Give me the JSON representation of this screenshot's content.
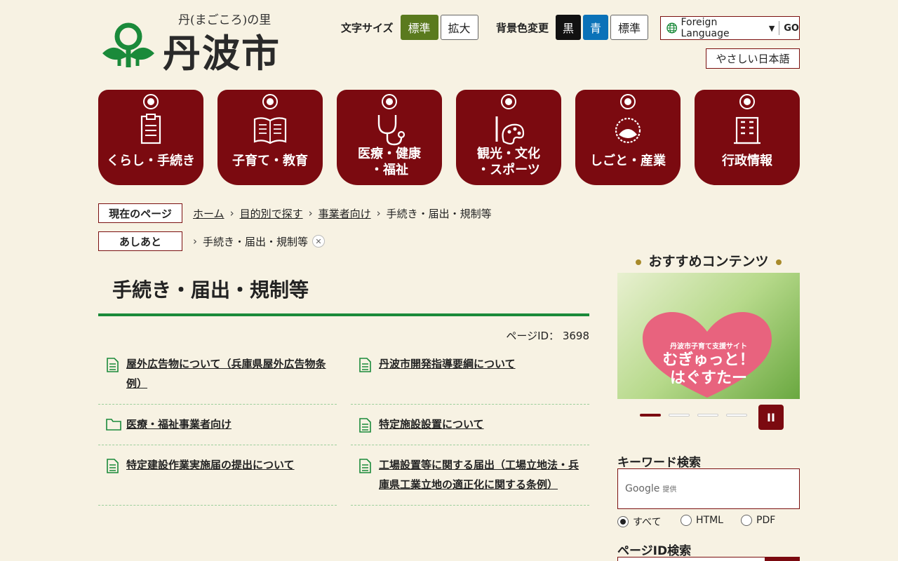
{
  "header": {
    "logo_subtitle": "丹(まごころ)の里",
    "logo_title": "丹波市",
    "font_size_label": "文字サイズ",
    "font_size_standard": "標準",
    "font_size_large": "拡大",
    "bg_label": "背景色変更",
    "bg_black": "黒",
    "bg_blue": "青",
    "bg_standard": "標準",
    "language_label": "Foreign Language",
    "language_go": "GO",
    "easy_japanese": "やさしい日本語"
  },
  "nav": {
    "items": [
      {
        "label": "くらし・手続き",
        "icon": "clipboard-icon"
      },
      {
        "label": "子育て・教育",
        "icon": "book-icon"
      },
      {
        "label_line1": "医療・健康",
        "label_line2": "・福祉",
        "icon": "stethoscope-icon"
      },
      {
        "label_line1": "観光・文化",
        "label_line2": "・スポーツ",
        "icon": "palette-icon"
      },
      {
        "label": "しごと・産業",
        "icon": "chestnut-icon"
      },
      {
        "label": "行政情報",
        "icon": "building-icon"
      }
    ]
  },
  "breadcrumb": {
    "current_label": "現在のページ",
    "home": "ホーム",
    "level1": "目的別で探す",
    "level2": "事業者向け",
    "current": "手続き・届出・規制等",
    "history_label": "あしあと",
    "history_item": "手続き・届出・規制等"
  },
  "main": {
    "title": "手続き・届出・規制等",
    "page_id": "ページID： 3698",
    "links": [
      {
        "text": "屋外広告物について（兵庫県屋外広告物条例）",
        "icon": "document-icon"
      },
      {
        "text": "丹波市開発指導要綱について",
        "icon": "document-icon"
      },
      {
        "text": "医療・福祉事業者向け",
        "icon": "folder-icon"
      },
      {
        "text": "特定施設設置について",
        "icon": "document-icon"
      },
      {
        "text": "特定建設作業実施届の提出について",
        "icon": "document-icon"
      },
      {
        "text": "工場設置等に関する届出（工場立地法・兵庫県工業立地の適正化に関する条例）",
        "icon": "document-icon"
      }
    ]
  },
  "sidebar": {
    "recommended_title": "おすすめコンテンツ",
    "banner_sub": "丹波市子育て支援サイト",
    "banner_line1": "むぎゅっと！",
    "banner_line2": "はぐすたー",
    "keyword_title": "キーワード検索",
    "google_label": "Google",
    "google_sub": "提供",
    "radio_all": "すべて",
    "radio_html": "HTML",
    "radio_pdf": "PDF",
    "pageid_title": "ページID検索"
  },
  "colors": {
    "brand": "#7b0a10",
    "accent_green": "#1a8a3a",
    "background": "#f7f2e3"
  }
}
